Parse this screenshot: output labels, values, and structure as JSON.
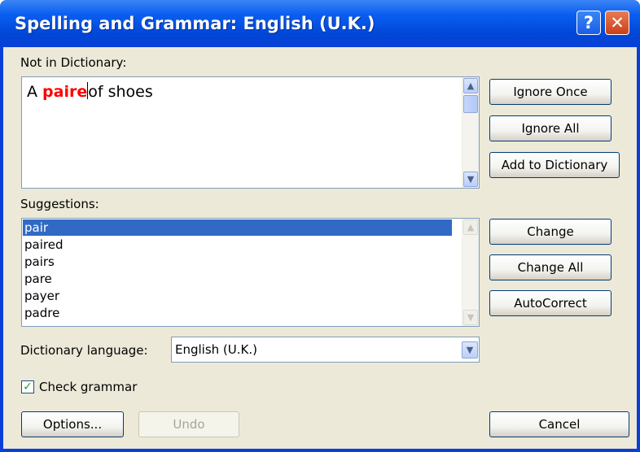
{
  "window": {
    "title": "Spelling and Grammar: English (U.K.)",
    "help_glyph": "?",
    "close_glyph": "✕"
  },
  "not_in_dictionary": {
    "label": "Not in Dictionary:",
    "sentence_before": "A ",
    "error_word": "paire",
    "sentence_after": "of shoes",
    "error_color": "#ff0000"
  },
  "suggestions": {
    "label": "Suggestions:",
    "items": [
      "pair",
      "paired",
      "pairs",
      "pare",
      "payer",
      "padre"
    ],
    "selected_index": 0
  },
  "dictionary_language": {
    "label": "Dictionary language:",
    "value": "English (U.K.)"
  },
  "check_grammar": {
    "label": "Check grammar",
    "checked": true
  },
  "buttons": {
    "ignore_once": "Ignore Once",
    "ignore_all": "Ignore All",
    "add_to_dictionary": "Add to Dictionary",
    "change": "Change",
    "change_all": "Change All",
    "autocorrect": "AutoCorrect",
    "options": "Options...",
    "undo": "Undo",
    "cancel": "Cancel"
  },
  "icons": {
    "scroll_up": "▲",
    "scroll_down": "▼",
    "dropdown": "▼",
    "check": "✓"
  }
}
